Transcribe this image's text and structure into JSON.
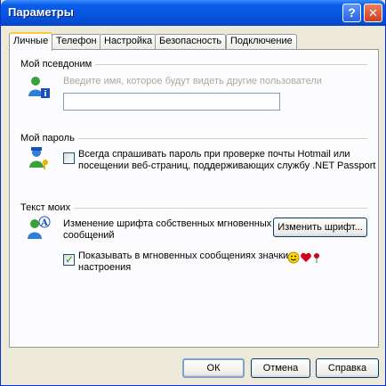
{
  "window": {
    "title": "Параметры"
  },
  "titlebar": {
    "help_label": "?",
    "close_label": "✕"
  },
  "tabs": [
    {
      "label": "Личные",
      "active": true
    },
    {
      "label": "Телефон",
      "active": false
    },
    {
      "label": "Настройка",
      "active": false
    },
    {
      "label": "Безопасность",
      "active": false
    },
    {
      "label": "Подключение",
      "active": false
    }
  ],
  "nickname": {
    "title": "Мой псевдоним",
    "hint": "Введите имя, которое будут видеть другие пользователи",
    "value": ""
  },
  "password": {
    "title": "Мой пароль",
    "checkbox_line1": "Всегда спрашивать пароль при проверке почты Hotmail или",
    "checkbox_line2": "посещении веб-страниц, поддерживающих службу .NET Passport",
    "checked": false
  },
  "text": {
    "title": "Текст моих",
    "font_line1": "Изменение шрифта собственных мгновенных",
    "font_line2": "сообщений",
    "change_font_button": "Изменить шрифт...",
    "emoticons_line1": "Показывать в мгновенных сообщениях значки",
    "emoticons_line2": "настроения",
    "emoticons_checked": true
  },
  "footer": {
    "ok": "ОК",
    "cancel": "Отмена",
    "help": "Справка"
  },
  "colors": {
    "titlebar": "#0655e0",
    "dialog_bg": "#ece9d8",
    "panel_bg": "#fcfcfe"
  }
}
